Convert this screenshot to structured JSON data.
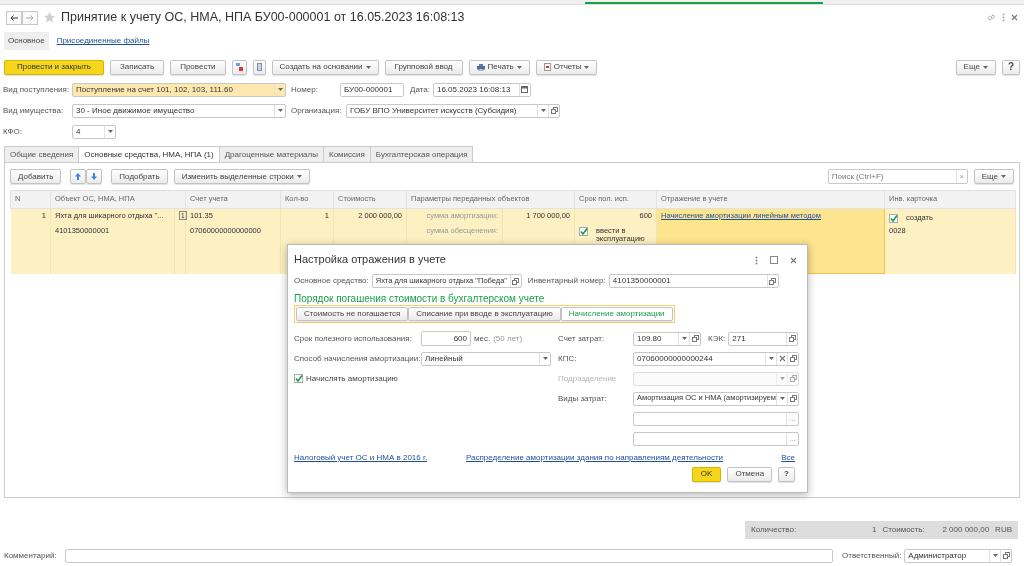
{
  "window": {
    "title": "Принятие к учету ОС, НМА, НПА БУ00-000001 от 16.05.2023 16:08:13",
    "favorite": false
  },
  "form_tabs": [
    {
      "label": "Основное",
      "selected": true
    },
    {
      "label": "Присоединенные файлы",
      "selected": false
    }
  ],
  "toolbar": [
    {
      "kind": "primary",
      "label": "Провести и закрыть"
    },
    {
      "kind": "button",
      "label": "Записать"
    },
    {
      "kind": "button",
      "label": "Провести"
    },
    {
      "kind": "ledger"
    },
    {
      "kind": "document"
    },
    {
      "kind": "dropdown",
      "label": "Создать на основании"
    },
    {
      "kind": "button",
      "label": "Групповой ввод"
    },
    {
      "kind": "print",
      "label": "Печать"
    },
    {
      "kind": "report",
      "label": "Отчеты"
    }
  ],
  "more_button": "Еще",
  "help_button": "?",
  "header": {
    "receipt_type": {
      "label": "Вид поступления:",
      "value": "Поступление на счет 101, 102, 103, 111.60"
    },
    "number": {
      "label": "Номер:",
      "value": "БУ00-000001"
    },
    "date": {
      "label": "Дата:",
      "value": "16.05.2023 16:08:13"
    },
    "property_type": {
      "label": "Вид имущества:",
      "value": "30 - Иное движимое имущество"
    },
    "organization": {
      "label": "Организация:",
      "value": "ГОБУ ВПО Университет искусств (Субсидия)"
    },
    "kfo": {
      "label": "КФО:",
      "value": "4"
    }
  },
  "tabs": [
    {
      "label": "Общие сведения",
      "selected": false
    },
    {
      "label": "Основные средства, НМА, НПА (1)",
      "selected": true
    },
    {
      "label": "Драгоценные материалы",
      "selected": false
    },
    {
      "label": "Комиссия",
      "selected": false
    },
    {
      "label": "Бухгалтерская операция",
      "selected": false
    }
  ],
  "table_toolbar": {
    "add": "Добавить",
    "pick": "Подобрать",
    "change": "Изменить выделенные строки",
    "search_placeholder": "Поиск (Ctrl+F)",
    "clear": "×",
    "more": "Еще"
  },
  "table": {
    "columns": [
      "N",
      "Объект ОС, НМА, НПА",
      "Счет учета",
      "Кол-во",
      "Стоимость",
      "Параметры переданных объектов",
      "Срок пол. исп.",
      "Отражение в учете",
      "Инв. карточка"
    ],
    "rows": [
      {
        "selected": true,
        "n": "1",
        "object": "Яхта для шикарного отдыха \"...",
        "object_marker": "1",
        "object_code": "4101350000001",
        "account": "101.35",
        "account_code": "07060000000000000",
        "quantity": "1",
        "cost": "2 000 000,00",
        "params": [
          {
            "label": "сумма амортизации:",
            "value": "1 700 000,00"
          },
          {
            "label": "сумма обесценения:"
          }
        ],
        "life": "600",
        "commission": {
          "label": "ввести в эксплуатацию",
          "checked": true
        },
        "reflection": "Начисление амортизации линейным методом",
        "card": {
          "label": "создать",
          "checked": true
        },
        "card_number": "0028"
      }
    ]
  },
  "dialog": {
    "title": "Настройка отражения в учете",
    "asset": {
      "label": "Основное средство:",
      "value": "Яхта для шикарного отдыха \"Победа\""
    },
    "inventory": {
      "label": "Инвентарный номер:",
      "value": "4101350000001"
    },
    "section_title": "Порядок погашения стоимости в бухгалтерском учете",
    "modes": [
      {
        "label": "Стоимость не погашается",
        "selected": false
      },
      {
        "label": "Списание при вводе в эксплуатацию",
        "selected": false
      },
      {
        "label": "Начисление амортизации",
        "selected": true
      }
    ],
    "life": {
      "label": "Срок полезного использования:",
      "value": "600",
      "unit": "мес.",
      "hint": "(50 лет)"
    },
    "method": {
      "label": "Способ начисления амортизации:",
      "value": "Линейный"
    },
    "accrue": {
      "label": "Начислять амортизацию",
      "checked": true
    },
    "cost_account": {
      "label": "Счет затрат:",
      "value": "109.80"
    },
    "kek": {
      "label": "КЭК:",
      "value": "271"
    },
    "kps": {
      "label": "КПС:",
      "value": "07060000000000244"
    },
    "department": {
      "label": "Подразделение",
      "disabled": true
    },
    "cost_types": {
      "label": "Виды затрат:",
      "value": "Амортизация ОС и НМА (амортизируем"
    },
    "analytics": [
      {
        "button": "..."
      },
      {
        "button": "..."
      }
    ],
    "links": [
      "Налоговый учет ОС и НМА в 2016 г.",
      "Распределение амортизации здания по направлениям деятельности",
      "Все"
    ],
    "ok": "OK",
    "cancel": "Отмена",
    "help": "?"
  },
  "totals": {
    "quantity_label": "Количество:",
    "quantity": "1",
    "cost_label": "Стоимость:",
    "cost": "2 000 000,00",
    "currency": "RUB"
  },
  "comment": {
    "label": "Комментарий:"
  },
  "responsible": {
    "label": "Ответственный:",
    "value": "Администратор"
  }
}
